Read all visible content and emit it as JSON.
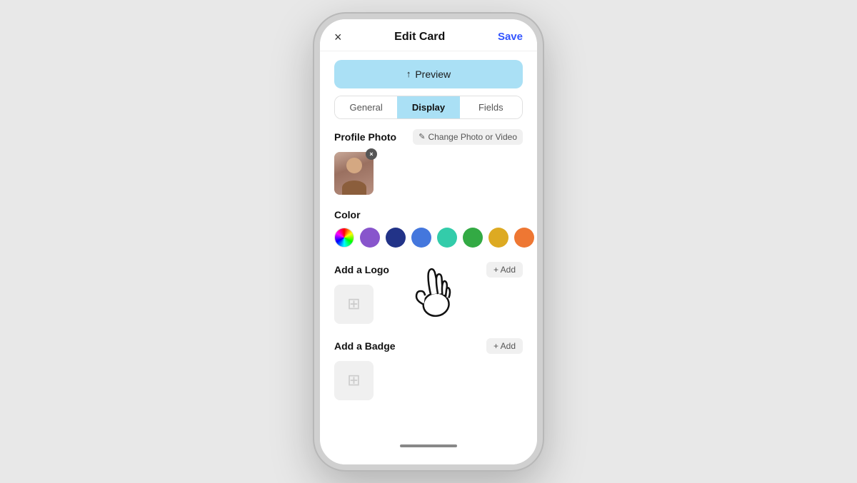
{
  "header": {
    "close_label": "×",
    "title": "Edit Card",
    "save_label": "Save"
  },
  "preview": {
    "icon": "↑",
    "label": "Preview"
  },
  "tabs": [
    {
      "id": "general",
      "label": "General",
      "active": false
    },
    {
      "id": "display",
      "label": "Display",
      "active": true
    },
    {
      "id": "fields",
      "label": "Fields",
      "active": false
    }
  ],
  "profile_photo": {
    "section_title": "Profile Photo",
    "change_btn_label": "Change Photo or Video",
    "remove_label": "×"
  },
  "color": {
    "section_title": "Color",
    "swatches": [
      {
        "id": "rainbow",
        "color": "rainbow"
      },
      {
        "id": "purple",
        "color": "#8855cc"
      },
      {
        "id": "dark-blue",
        "color": "#223388"
      },
      {
        "id": "medium-blue",
        "color": "#4477dd"
      },
      {
        "id": "teal",
        "color": "#33ccaa"
      },
      {
        "id": "green",
        "color": "#33aa44"
      },
      {
        "id": "yellow",
        "color": "#ddaa22"
      },
      {
        "id": "orange",
        "color": "#ee7733"
      }
    ]
  },
  "logo": {
    "section_title": "Add a Logo",
    "add_label": "+ Add"
  },
  "badge": {
    "section_title": "Add a Badge",
    "add_label": "+ Add"
  }
}
